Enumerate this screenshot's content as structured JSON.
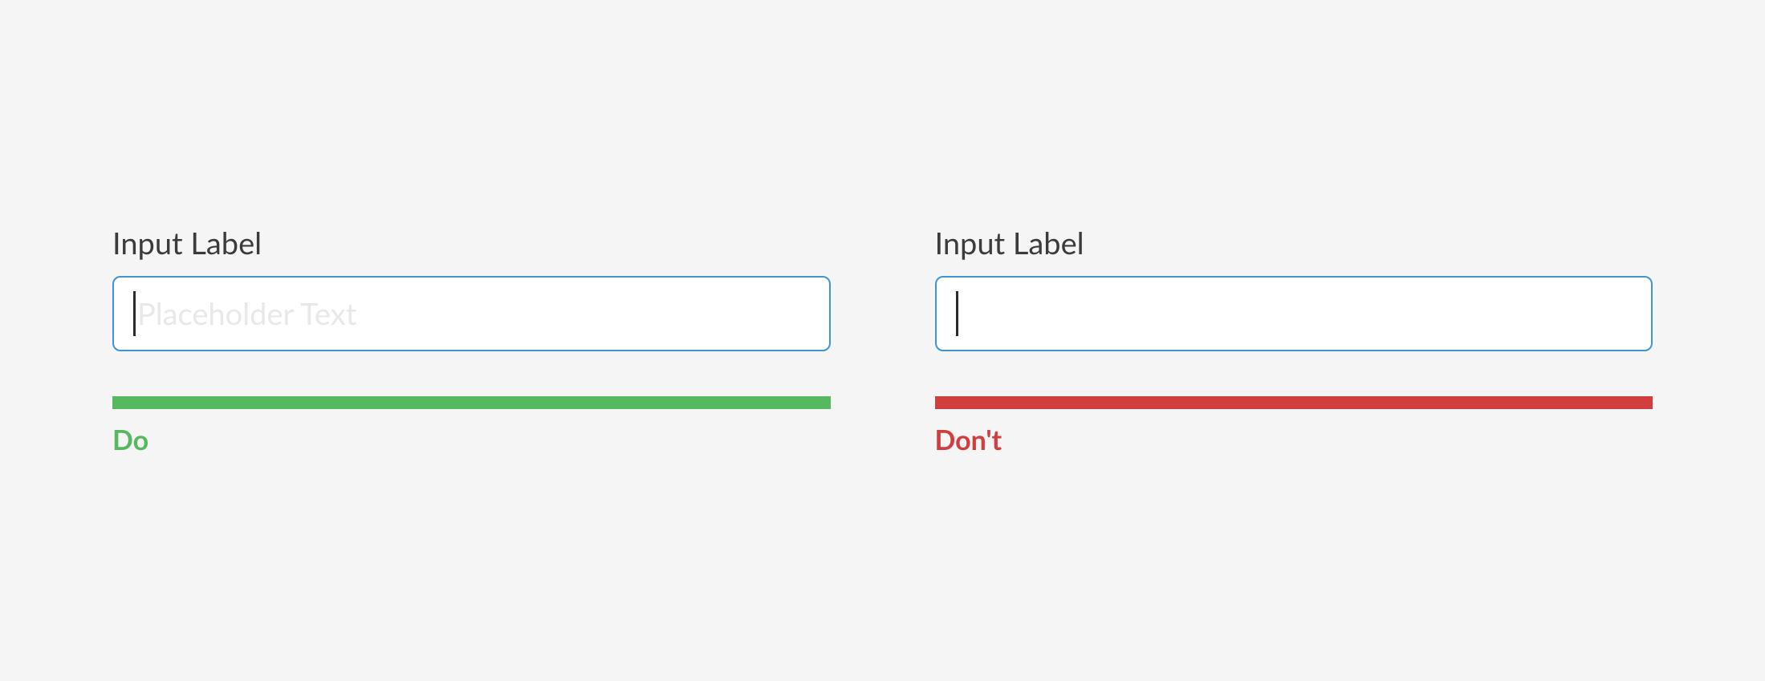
{
  "do": {
    "label": "Input Label",
    "placeholder": "Placeholder Text",
    "status": "Do"
  },
  "dont": {
    "label": "Input Label",
    "placeholder": "",
    "status": "Don't"
  },
  "colors": {
    "do": "#56b95e",
    "dont": "#d13e3e",
    "border": "#3d95d6"
  }
}
